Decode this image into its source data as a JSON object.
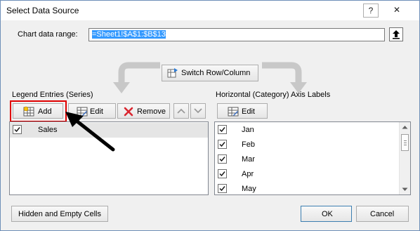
{
  "window": {
    "title": "Select Data Source",
    "help_glyph": "?",
    "close_glyph": "✕"
  },
  "range": {
    "label": "Chart data range:",
    "value": "=Sheet1!$A$1:$B$13"
  },
  "switch_button": {
    "label": "Switch Row/Column"
  },
  "legend": {
    "heading": "Legend Entries (Series)",
    "add_label": "Add",
    "edit_label": "Edit",
    "remove_label": "Remove",
    "items": [
      {
        "label": "Sales",
        "checked": true
      }
    ]
  },
  "axis": {
    "heading": "Horizontal (Category) Axis Labels",
    "edit_label": "Edit",
    "items": [
      {
        "label": "Jan",
        "checked": true
      },
      {
        "label": "Feb",
        "checked": true
      },
      {
        "label": "Mar",
        "checked": true
      },
      {
        "label": "Apr",
        "checked": true
      },
      {
        "label": "May",
        "checked": true
      }
    ]
  },
  "footer": {
    "hidden_cells_label": "Hidden and Empty Cells",
    "ok_label": "OK",
    "cancel_label": "Cancel"
  },
  "colors": {
    "highlight_box": "#e00000",
    "pointer_arrow": "#000000",
    "remove_x": "#d9262f",
    "ok_border": "#3c7fb1"
  }
}
